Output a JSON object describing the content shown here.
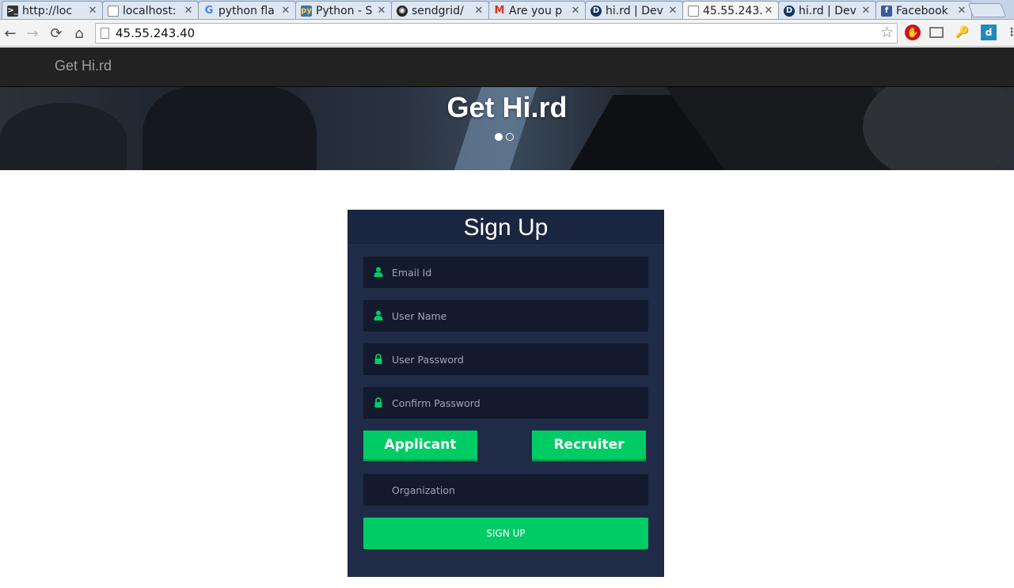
{
  "browser": {
    "tabs": [
      {
        "title": "http://loc",
        "icon": "terminal-icon"
      },
      {
        "title": "localhost:",
        "icon": "page-icon"
      },
      {
        "title": "python fla",
        "icon": "google-icon"
      },
      {
        "title": "Python - S",
        "icon": "python-icon"
      },
      {
        "title": "sendgrid/",
        "icon": "github-icon"
      },
      {
        "title": "Are you p",
        "icon": "gmail-icon"
      },
      {
        "title": "hi.rd | Dev",
        "icon": "d-icon"
      },
      {
        "title": "45.55.243.",
        "icon": "page-icon"
      },
      {
        "title": "hi.rd | Dev",
        "icon": "d-icon"
      },
      {
        "title": "Facebook",
        "icon": "facebook-icon"
      }
    ],
    "active_tab_index": 7,
    "url": "45.55.243.40"
  },
  "site": {
    "brand": "Get Hi.rd",
    "hero_title": "Get Hi.rd",
    "carousel_dots": 2,
    "carousel_active": 0
  },
  "signup": {
    "title": "Sign Up",
    "fields": [
      {
        "placeholder": "Email Id",
        "icon": "user-icon"
      },
      {
        "placeholder": "User Name",
        "icon": "user-icon"
      },
      {
        "placeholder": "User Password",
        "icon": "lock-icon"
      },
      {
        "placeholder": "Confirm Password",
        "icon": "lock-icon"
      }
    ],
    "applicant_label": "Applicant",
    "recruiter_label": "Recruiter",
    "organization_placeholder": "Organization",
    "submit_label": "SIGN UP"
  },
  "colors": {
    "accent_green": "#00cc66",
    "card_bg": "#1f2b47",
    "field_bg": "#141a2e",
    "navbar_bg": "#222222"
  }
}
